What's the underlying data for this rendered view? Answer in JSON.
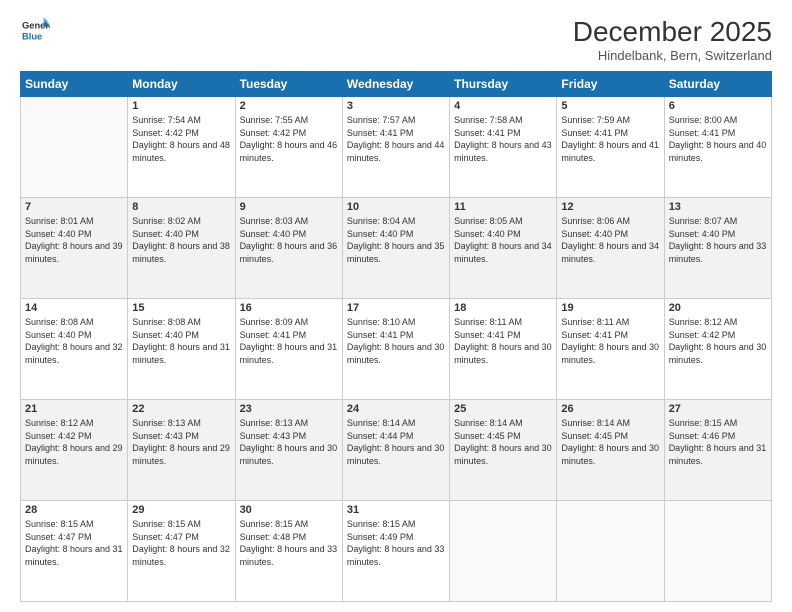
{
  "logo": {
    "general": "General",
    "blue": "Blue"
  },
  "header": {
    "month": "December 2025",
    "location": "Hindelbank, Bern, Switzerland"
  },
  "days_of_week": [
    "Sunday",
    "Monday",
    "Tuesday",
    "Wednesday",
    "Thursday",
    "Friday",
    "Saturday"
  ],
  "weeks": [
    [
      {
        "day": null
      },
      {
        "day": 1,
        "sunrise": "7:54 AM",
        "sunset": "4:42 PM",
        "daylight": "8 hours and 48 minutes."
      },
      {
        "day": 2,
        "sunrise": "7:55 AM",
        "sunset": "4:42 PM",
        "daylight": "8 hours and 46 minutes."
      },
      {
        "day": 3,
        "sunrise": "7:57 AM",
        "sunset": "4:41 PM",
        "daylight": "8 hours and 44 minutes."
      },
      {
        "day": 4,
        "sunrise": "7:58 AM",
        "sunset": "4:41 PM",
        "daylight": "8 hours and 43 minutes."
      },
      {
        "day": 5,
        "sunrise": "7:59 AM",
        "sunset": "4:41 PM",
        "daylight": "8 hours and 41 minutes."
      },
      {
        "day": 6,
        "sunrise": "8:00 AM",
        "sunset": "4:41 PM",
        "daylight": "8 hours and 40 minutes."
      }
    ],
    [
      {
        "day": 7,
        "sunrise": "8:01 AM",
        "sunset": "4:40 PM",
        "daylight": "8 hours and 39 minutes."
      },
      {
        "day": 8,
        "sunrise": "8:02 AM",
        "sunset": "4:40 PM",
        "daylight": "8 hours and 38 minutes."
      },
      {
        "day": 9,
        "sunrise": "8:03 AM",
        "sunset": "4:40 PM",
        "daylight": "8 hours and 36 minutes."
      },
      {
        "day": 10,
        "sunrise": "8:04 AM",
        "sunset": "4:40 PM",
        "daylight": "8 hours and 35 minutes."
      },
      {
        "day": 11,
        "sunrise": "8:05 AM",
        "sunset": "4:40 PM",
        "daylight": "8 hours and 34 minutes."
      },
      {
        "day": 12,
        "sunrise": "8:06 AM",
        "sunset": "4:40 PM",
        "daylight": "8 hours and 34 minutes."
      },
      {
        "day": 13,
        "sunrise": "8:07 AM",
        "sunset": "4:40 PM",
        "daylight": "8 hours and 33 minutes."
      }
    ],
    [
      {
        "day": 14,
        "sunrise": "8:08 AM",
        "sunset": "4:40 PM",
        "daylight": "8 hours and 32 minutes."
      },
      {
        "day": 15,
        "sunrise": "8:08 AM",
        "sunset": "4:40 PM",
        "daylight": "8 hours and 31 minutes."
      },
      {
        "day": 16,
        "sunrise": "8:09 AM",
        "sunset": "4:41 PM",
        "daylight": "8 hours and 31 minutes."
      },
      {
        "day": 17,
        "sunrise": "8:10 AM",
        "sunset": "4:41 PM",
        "daylight": "8 hours and 30 minutes."
      },
      {
        "day": 18,
        "sunrise": "8:11 AM",
        "sunset": "4:41 PM",
        "daylight": "8 hours and 30 minutes."
      },
      {
        "day": 19,
        "sunrise": "8:11 AM",
        "sunset": "4:41 PM",
        "daylight": "8 hours and 30 minutes."
      },
      {
        "day": 20,
        "sunrise": "8:12 AM",
        "sunset": "4:42 PM",
        "daylight": "8 hours and 30 minutes."
      }
    ],
    [
      {
        "day": 21,
        "sunrise": "8:12 AM",
        "sunset": "4:42 PM",
        "daylight": "8 hours and 29 minutes."
      },
      {
        "day": 22,
        "sunrise": "8:13 AM",
        "sunset": "4:43 PM",
        "daylight": "8 hours and 29 minutes."
      },
      {
        "day": 23,
        "sunrise": "8:13 AM",
        "sunset": "4:43 PM",
        "daylight": "8 hours and 30 minutes."
      },
      {
        "day": 24,
        "sunrise": "8:14 AM",
        "sunset": "4:44 PM",
        "daylight": "8 hours and 30 minutes."
      },
      {
        "day": 25,
        "sunrise": "8:14 AM",
        "sunset": "4:45 PM",
        "daylight": "8 hours and 30 minutes."
      },
      {
        "day": 26,
        "sunrise": "8:14 AM",
        "sunset": "4:45 PM",
        "daylight": "8 hours and 30 minutes."
      },
      {
        "day": 27,
        "sunrise": "8:15 AM",
        "sunset": "4:46 PM",
        "daylight": "8 hours and 31 minutes."
      }
    ],
    [
      {
        "day": 28,
        "sunrise": "8:15 AM",
        "sunset": "4:47 PM",
        "daylight": "8 hours and 31 minutes."
      },
      {
        "day": 29,
        "sunrise": "8:15 AM",
        "sunset": "4:47 PM",
        "daylight": "8 hours and 32 minutes."
      },
      {
        "day": 30,
        "sunrise": "8:15 AM",
        "sunset": "4:48 PM",
        "daylight": "8 hours and 33 minutes."
      },
      {
        "day": 31,
        "sunrise": "8:15 AM",
        "sunset": "4:49 PM",
        "daylight": "8 hours and 33 minutes."
      },
      {
        "day": null
      },
      {
        "day": null
      },
      {
        "day": null
      }
    ]
  ]
}
